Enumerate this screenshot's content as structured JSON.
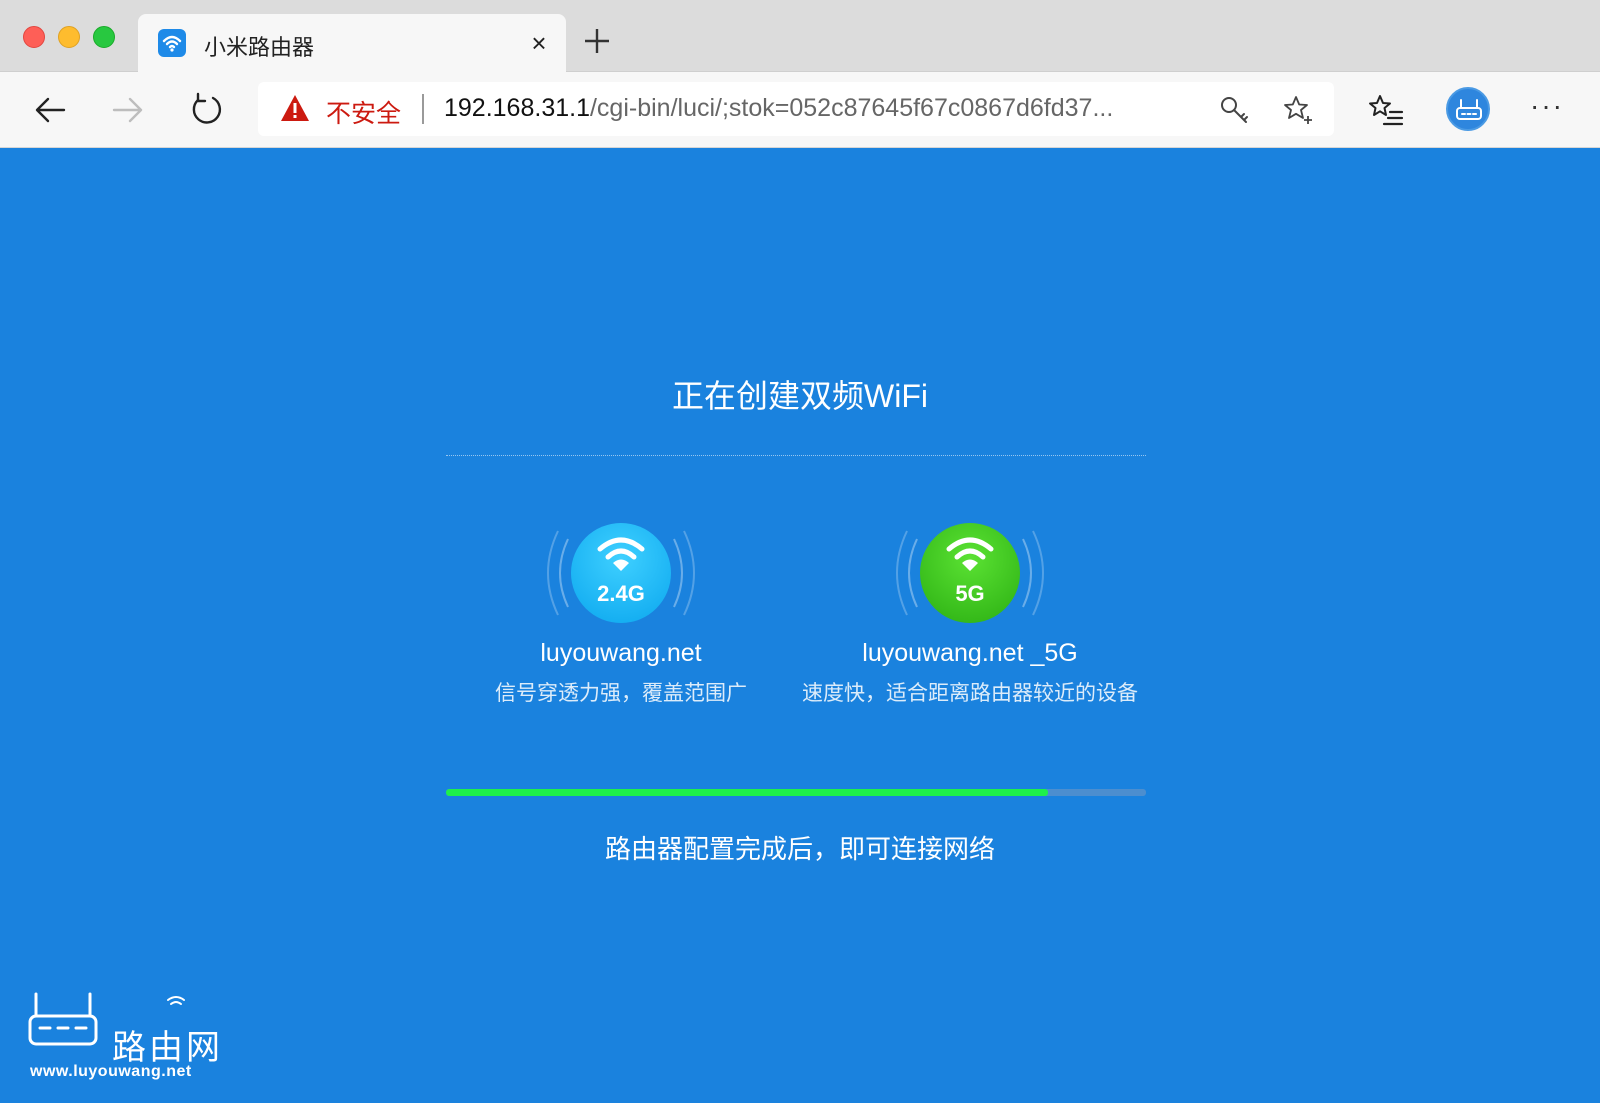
{
  "browser": {
    "tab": {
      "title": "小米路由器",
      "close_label": "×"
    },
    "address_bar": {
      "security_label": "不安全",
      "url_host": "192.168.31.1",
      "url_path": "/cgi-bin/luci/;stok=052c87645f67c0867d6fd37..."
    },
    "more_label": "···",
    "icons": {
      "close_window": "close-window-icon",
      "minimize": "minimize-icon",
      "zoom": "zoom-icon",
      "favicon": "wifi-icon",
      "new_tab": "plus-icon",
      "back": "back-arrow-icon",
      "forward": "forward-arrow-icon",
      "reload": "reload-icon",
      "warning": "warning-triangle-icon",
      "key": "key-icon",
      "star": "star-add-icon",
      "favorites": "favorites-list-icon",
      "profile": "router-profile-icon"
    }
  },
  "page": {
    "heading": "正在创建双频WiFi",
    "bands": [
      {
        "badge": "2.4G",
        "ssid": "luyouwang.net",
        "description": "信号穿透力强，覆盖范围广",
        "color": "#10b1f2"
      },
      {
        "badge": "5G",
        "ssid": "luyouwang.net _5G",
        "description": "速度快，适合距离路由器较近的设备",
        "color": "#3cc51e"
      }
    ],
    "progress": {
      "fraction": 0.86,
      "color": "#1ef04a"
    },
    "progress_text": "路由器配置完成后，即可连接网络"
  },
  "watermark": {
    "brand_text": "路由网",
    "url": "www.luyouwang.net"
  }
}
